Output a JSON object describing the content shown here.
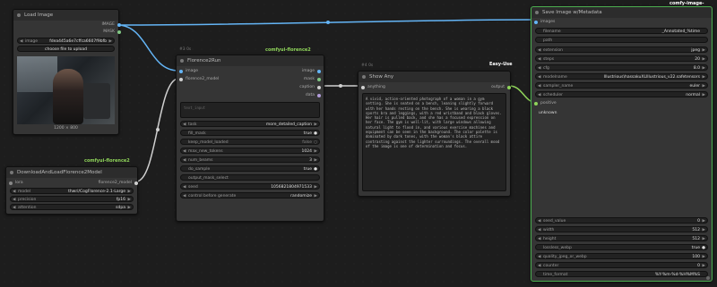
{
  "load_image": {
    "title": "Load Image",
    "out_image": "IMAGE",
    "out_mask": "MASK",
    "image_label": "image",
    "image_value": "fdea445a6e7cffca6607f9bfb",
    "upload_label": "choose file to upload",
    "size_caption": "1200 × 800"
  },
  "florence_model": {
    "badge": "comfyui-florence2",
    "title": "DownloadAndLoadFlorence2Model",
    "in_lora": "lora",
    "out_model": "florence2_model",
    "widgets": [
      {
        "label": "model",
        "value": "thwri/CogFlorence-2.1-Large"
      },
      {
        "label": "precision",
        "value": "fp16"
      },
      {
        "label": "attention",
        "value": "sdpa"
      }
    ]
  },
  "florence_run": {
    "meta": "#3 0s",
    "badge": "comfyui-florence2",
    "title": "Florence2Run",
    "in_image": "image",
    "in_model": "florence2_model",
    "out_image": "image",
    "out_mask": "mask",
    "out_caption": "caption",
    "out_data": "data",
    "text_input_placeholder": "text_input",
    "widgets": [
      {
        "label": "task",
        "value": "more_detailed_caption"
      },
      {
        "label": "fill_mask",
        "value": "true"
      },
      {
        "label": "keep_model_loaded",
        "value": "false"
      },
      {
        "label": "max_new_tokens",
        "value": "1024"
      },
      {
        "label": "num_beams",
        "value": "3"
      },
      {
        "label": "do_sample",
        "value": "true"
      },
      {
        "label": "output_mask_select",
        "value": ""
      },
      {
        "label": "seed",
        "value": "1056821804971533"
      },
      {
        "label": "control before generate",
        "value": "randomize"
      }
    ]
  },
  "show_any": {
    "meta": "#4 0s",
    "badge": "Easy-Use",
    "title": "Show Any",
    "in_anything": "anything",
    "out_output": "output",
    "text": "A vivid, action-oriented photograph of a woman in a gym setting. She is seated on a bench, leaning slightly forward with her hands resting on the bench. She is wearing a black sports bra and leggings, with a red wristband and black gloves. Her hair is pulled back, and she has a focused expression on her face. The gym is well-lit, with large windows allowing natural light to flood in, and various exercise machines and equipment can be seen in the background. The color palette is dominated by dark tones, with the woman's black attire contrasting against the lighter surroundings. The overall mood of the image is one of determination and focus."
  },
  "save_image": {
    "badge": "comfy-image-saver",
    "title": "Save Image w/Metadata",
    "in_images": "images",
    "in_positive": "positive",
    "unknown_label": "unknown",
    "top_widgets": [
      {
        "label": "filename",
        "value": "_Annotated_%time",
        "kind": "text"
      },
      {
        "label": "path",
        "value": "",
        "kind": "text"
      },
      {
        "label": "extension",
        "value": "jpeg",
        "kind": "combo"
      },
      {
        "label": "steps",
        "value": "20",
        "kind": "number"
      },
      {
        "label": "cfg",
        "value": "8.0",
        "kind": "number"
      },
      {
        "label": "modelname",
        "value": "Illustrious\\hassakuXLIllustrious_v22.safetensors",
        "kind": "combo"
      },
      {
        "label": "sampler_name",
        "value": "euler",
        "kind": "combo"
      },
      {
        "label": "scheduler",
        "value": "normal",
        "kind": "combo"
      }
    ],
    "bottom_widgets": [
      {
        "label": "seed_value",
        "value": "0"
      },
      {
        "label": "width",
        "value": "512"
      },
      {
        "label": "height",
        "value": "512"
      },
      {
        "label": "lossless_webp",
        "value": "true"
      },
      {
        "label": "quality_jpeg_or_webp",
        "value": "100"
      },
      {
        "label": "counter",
        "value": "0"
      },
      {
        "label": "time_format",
        "value": "%Y-%m-%d-%H%M%S"
      }
    ]
  },
  "colors": {
    "link_image": "#64b5f6",
    "link_model": "#d0d0d0",
    "link_string": "#8fd45a",
    "slot_image": "#64b5f6",
    "slot_mask": "#81c784",
    "slot_any": "#aaaaaa",
    "selected_border": "#4caf50"
  }
}
